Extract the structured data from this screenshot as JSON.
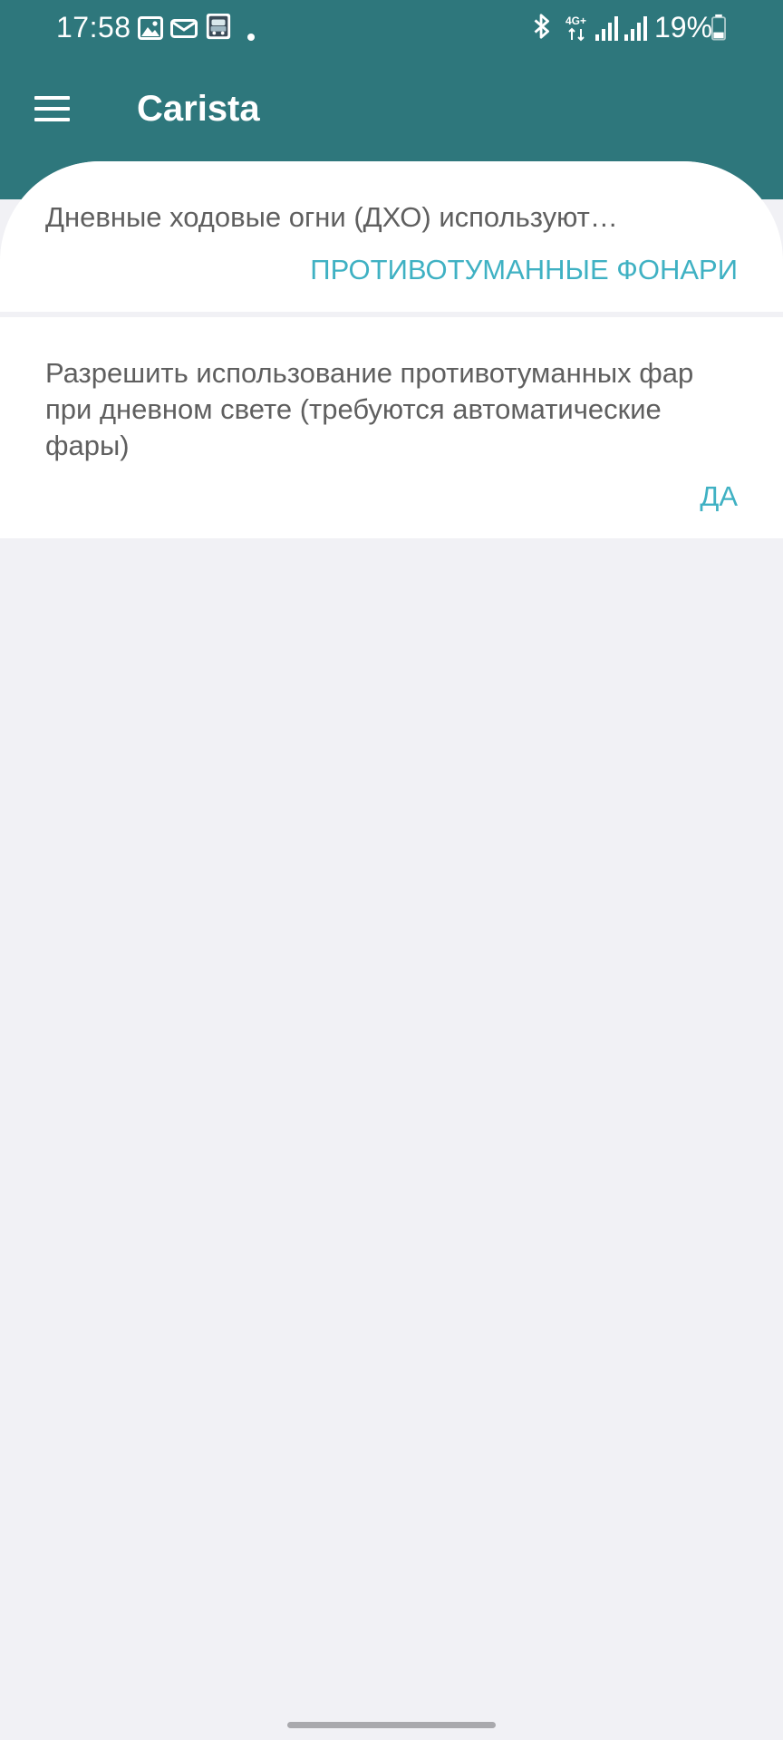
{
  "status_bar": {
    "time": "17:58",
    "notification_icons": [
      "gallery-icon",
      "email-icon",
      "car-app-icon",
      "dot-icon"
    ],
    "system_icons": [
      "bluetooth-icon",
      "network-4g-plus-icon",
      "signal-icon",
      "signal-icon"
    ],
    "network_label": "4G+",
    "battery_percent": "19%"
  },
  "app_bar": {
    "title": "Carista",
    "menu_icon": "hamburger-menu-icon"
  },
  "settings": [
    {
      "label": "Дневные ходовые огни (ДХО) используют…",
      "value": "ПРОТИВОТУМАННЫЕ ФОНАРИ"
    },
    {
      "label": "Разрешить использование противотуманных фар при дневном свете (требуются автоматические фары)",
      "value": "ДА"
    }
  ],
  "colors": {
    "header": "#2e777c",
    "accent": "#3fb1c3",
    "background": "#f1f1f5",
    "text": "#5f5f5f"
  }
}
